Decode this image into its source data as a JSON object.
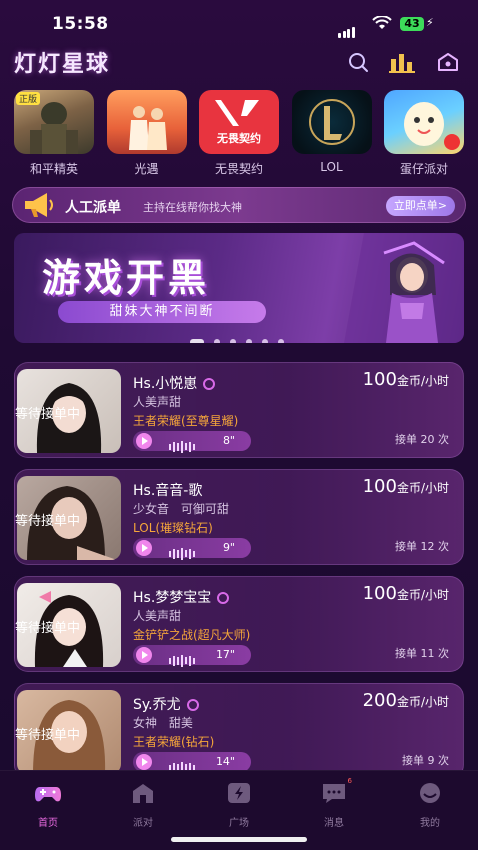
{
  "status_bar": {
    "time": "15:58",
    "battery": "43"
  },
  "header": {
    "title": "灯灯星球"
  },
  "games": [
    {
      "name": "和平精英",
      "badge": "正版"
    },
    {
      "name": "光遇"
    },
    {
      "name": "无畏契约",
      "logo_text": "无畏契约"
    },
    {
      "name": "LOL"
    },
    {
      "name": "蛋仔派对"
    }
  ],
  "dispatch": {
    "title": "人工派单",
    "subtitle": "主持在线帮你找大神",
    "button": "立即点单>"
  },
  "banner": {
    "headline": "游戏开黑",
    "tagline": "甜妹大神不间断",
    "slides": 6,
    "active_slide": 0
  },
  "cards": [
    {
      "name": "Hs.小悦崽",
      "tags": "人美声甜",
      "game": "王者荣耀(至尊星耀)",
      "voice": "8\"",
      "price": "100",
      "unit": "金币/小时",
      "status": "等待接单中",
      "orders": "接单 20 次"
    },
    {
      "name": "Hs.音音-歌",
      "tags": "少女音 可御可甜",
      "game": "LOL(璀璨钻石)",
      "voice": "9\"",
      "price": "100",
      "unit": "金币/小时",
      "status": "等待接单中",
      "orders": "接单 12 次"
    },
    {
      "name": "Hs.梦梦宝宝",
      "tags": "人美声甜",
      "game": "金铲铲之战(超凡大师)",
      "voice": "17\"",
      "price": "100",
      "unit": "金币/小时",
      "status": "等待接单中",
      "orders": "接单 11 次"
    },
    {
      "name": "Sy.乔尤",
      "tags": "女神 甜美",
      "game": "王者荣耀(钻石)",
      "voice": "14\"",
      "price": "200",
      "unit": "金币/小时",
      "status": "等待接单中",
      "orders": "接单 9 次"
    }
  ],
  "tabs": [
    {
      "label": "首页",
      "icon": "gamepad-icon",
      "active": true
    },
    {
      "label": "派对",
      "icon": "house-icon"
    },
    {
      "label": "广场",
      "icon": "bolt-icon"
    },
    {
      "label": "消息",
      "icon": "chat-icon",
      "badge": "6"
    },
    {
      "label": "我的",
      "icon": "profile-icon"
    }
  ],
  "colors": {
    "accent": "#e86ae0",
    "price_tag": "#f5a63a",
    "background": "#1f0a33"
  }
}
